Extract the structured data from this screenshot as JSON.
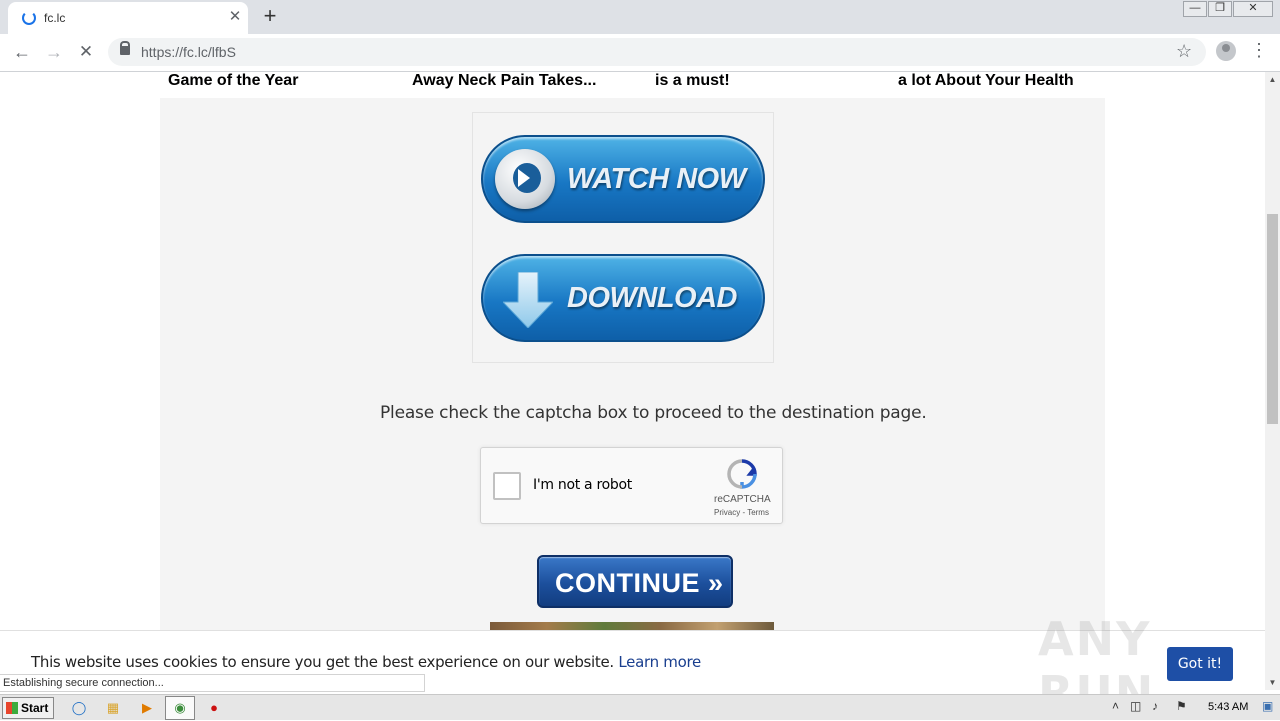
{
  "browser": {
    "tab_title": "fc.lc",
    "tab_close_glyph": "✕",
    "new_tab_glyph": "+",
    "url": "https://fc.lc/lfbS",
    "window_controls": [
      "—",
      "❐",
      "✕"
    ]
  },
  "page": {
    "headlines": [
      "Game of the Year",
      "Away Neck Pain Takes...",
      "is a must!",
      "a lot About Your Health"
    ],
    "watch_now_label": "WATCH NOW",
    "download_label": "DOWNLOAD",
    "captcha_message": "Please check the captcha box to proceed to the destination page.",
    "recaptcha": {
      "label": "I'm not a robot",
      "brand": "reCAPTCHA",
      "links": "Privacy - Terms"
    },
    "continue_label": "CONTINUE »"
  },
  "cookie_bar": {
    "text": "This website uses cookies to ensure you get the best experience on our website.",
    "link": "Learn more",
    "button": "Got it!"
  },
  "status_bubble": "Establishing secure connection...",
  "watermark": "ANY RUN",
  "taskbar": {
    "start_label": "Start",
    "clock": "5:43 AM"
  },
  "colors": {
    "accent_blue": "#1877c4",
    "continue_blue": "#1c4f9c",
    "cookie_button": "#1e4fa6",
    "link_blue": "#1a3f8f"
  }
}
